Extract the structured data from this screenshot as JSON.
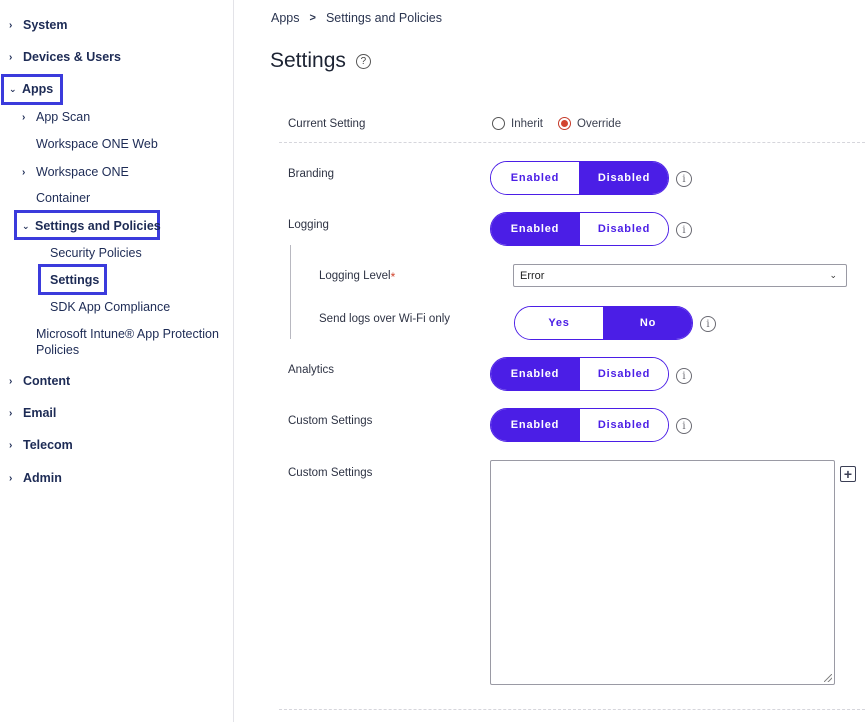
{
  "sidebar": {
    "top_items": {
      "system": "System",
      "devices_users": "Devices & Users",
      "apps": "Apps",
      "content": "Content",
      "email": "Email",
      "telecom": "Telecom",
      "admin": "Admin"
    },
    "apps_children": {
      "app_scan": "App Scan",
      "workspace_one_web": "Workspace ONE Web",
      "workspace_one": "Workspace ONE",
      "container": "Container",
      "settings_and_policies": "Settings and Policies",
      "intune": "Microsoft Intune® App Protection Policies"
    },
    "settings_children": {
      "security_policies": "Security Policies",
      "settings": "Settings",
      "sdk_app_compliance": "SDK App Compliance"
    },
    "highlight_color": "#3b3bdc"
  },
  "breadcrumb": {
    "root": "Apps",
    "current": "Settings and Policies"
  },
  "page_title": "Settings",
  "current_setting": {
    "label": "Current Setting",
    "options": {
      "inherit": "Inherit",
      "override": "Override"
    },
    "selected": "Override"
  },
  "branding": {
    "label": "Branding",
    "enabled": "Enabled",
    "disabled": "Disabled",
    "selected": "Disabled"
  },
  "logging": {
    "label": "Logging",
    "enabled": "Enabled",
    "disabled": "Disabled",
    "selected": "Enabled"
  },
  "logging_level": {
    "label": "Logging Level",
    "required_mark": "*",
    "value": "Error"
  },
  "send_logs": {
    "label": "Send logs over Wi-Fi only",
    "yes": "Yes",
    "no": "No",
    "selected": "No"
  },
  "analytics": {
    "label": "Analytics",
    "enabled": "Enabled",
    "disabled": "Disabled",
    "selected": "Enabled"
  },
  "custom_settings_toggle": {
    "label": "Custom Settings",
    "enabled": "Enabled",
    "disabled": "Disabled",
    "selected": "Enabled"
  },
  "custom_settings_text": {
    "label": "Custom Settings",
    "value": ""
  },
  "colors": {
    "accent": "#4b1ee6",
    "radio_selected": "#d2442f"
  }
}
